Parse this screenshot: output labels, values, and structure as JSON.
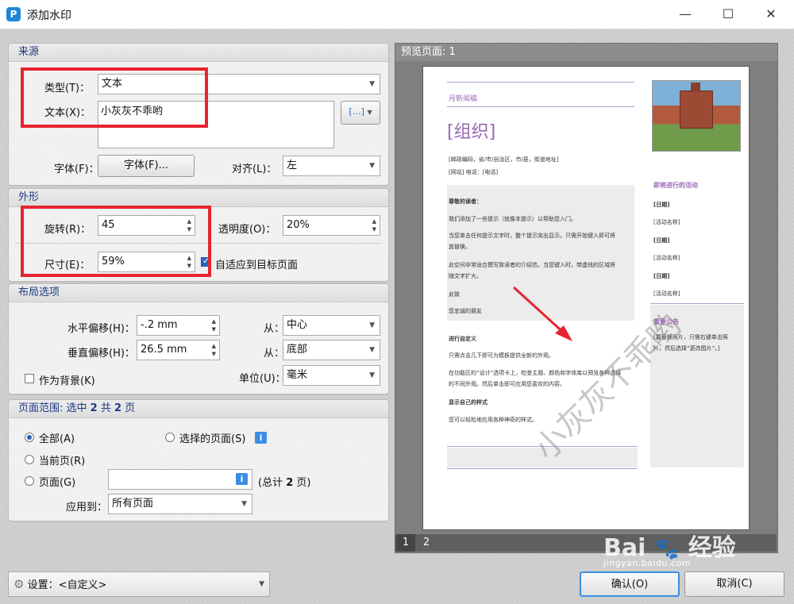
{
  "window": {
    "title": "添加水印",
    "minimize": "—",
    "maximize": "☐",
    "close": "✕",
    "app_icon": "P"
  },
  "source": {
    "header": "来源",
    "type_label": "类型(T)：",
    "type_value": "文本",
    "text_label": "文本(X)：",
    "text_value": "小灰灰不乖哟",
    "font_label": "字体(F)：",
    "font_button": "字体(F)...",
    "align_label": "对齐(L)：",
    "align_value": "左",
    "macro_icon": "[…]"
  },
  "appearance": {
    "header": "外形",
    "rotate_label": "旋转(R)：",
    "rotate_value": "45",
    "opacity_label": "透明度(O)：",
    "opacity_value": "20%",
    "size_label": "尺寸(E)：",
    "size_value": "59%",
    "fit_label": "自适应到目标页面",
    "fit_checked": true
  },
  "layout": {
    "header": "布局选项",
    "h_offset_label": "水平偏移(H)：",
    "h_offset_value": "-.2 mm",
    "h_from_label": "从：",
    "h_from_value": "中心",
    "v_offset_label": "垂直偏移(H)：",
    "v_offset_value": "26.5 mm",
    "v_from_label": "从：",
    "v_from_value": "底部",
    "bg_label": "作为背景(K)",
    "bg_checked": false,
    "unit_label": "单位(U)：",
    "unit_value": "毫米"
  },
  "range": {
    "header_prefix": "页面范围: 选中 ",
    "selected": "2",
    "header_mid": " 共 ",
    "total": "2",
    "header_suffix": " 页",
    "all_label": "全部(A)",
    "selected_pages_label": "选择的页面(S)",
    "current_label": "当前页(R)",
    "pages_label": "页面(G)",
    "pages_value": "",
    "total_note_prefix": "(总计 ",
    "total_note_num": "2",
    "total_note_suffix": " 页)",
    "apply_label": "应用到：",
    "apply_value": "所有页面"
  },
  "preview": {
    "header": "预览页面: 1",
    "pages": [
      "1",
      "2"
    ],
    "watermark": "小灰灰不乖哟",
    "doc": {
      "newsletter": "月新闻稿",
      "org": "[组织]",
      "address": "[邮政编码，省/市/自治区，市/县，街道地址]",
      "contact": "[网站]  电话：[电话]",
      "greeting": "尊敬的读者：",
      "p1": "我们添加了一些提示（就像本提示）以帮助您入门。",
      "p2a": "当您单击任何提示文字时，整个提示突出显示。只需开始键入即可将",
      "p2b": "其替换。",
      "p3a": "此空间非常适合撰写致读者的介绍信。当您键入时，带虚线的区域将",
      "p3b": "随文字扩大。",
      "closing": "此致",
      "sign": "您忠诚的朋友",
      "h_custom": "进行自定义",
      "c1": "只需点击几下即可为模板提供全新的外观。",
      "c2a": "在功能区的“设计”选项卡上，检查主题、颜色和字体库以预览各种选择",
      "c2b": "的不同外观。然后单击即可应用您喜欢的内容。",
      "h_style": "显示自己的样式",
      "s1": "您可以轻松地应用各种神奇的样式。",
      "upcoming": "即将进行的活动",
      "date": "[日期]",
      "event": "[活动名称]",
      "notice": "重要公告",
      "notice1": "[要替换照片，只需右键单击照",
      "notice2": "片，然后选择“更改图片”。]"
    }
  },
  "footer": {
    "settings_label": "设置：<自定义>",
    "ok": "确认(O)",
    "cancel": "取消(C)",
    "site": "jingyan.baidu.com",
    "brand": "Bai",
    "brand_tail": "经验"
  },
  "colors": {
    "accent": "#1d3a80",
    "highlight": "#e8242e",
    "doc_purple": "#9a67b4"
  }
}
